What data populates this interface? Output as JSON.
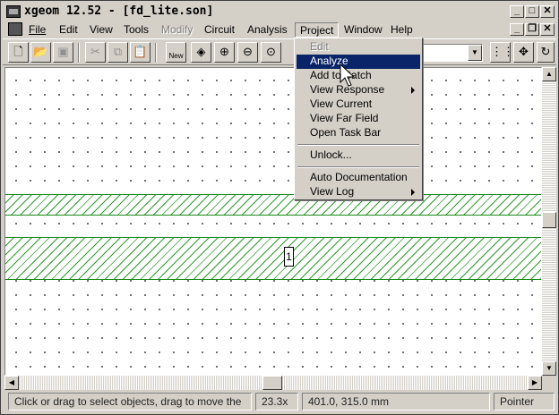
{
  "window": {
    "title": "xgeom 12.52 - [fd_lite.son]"
  },
  "menubar": {
    "items": [
      {
        "label": "File",
        "state": "normal"
      },
      {
        "label": "Edit",
        "state": "normal"
      },
      {
        "label": "View",
        "state": "normal"
      },
      {
        "label": "Tools",
        "state": "normal"
      },
      {
        "label": "Modify",
        "state": "disabled"
      },
      {
        "label": "Circuit",
        "state": "normal"
      },
      {
        "label": "Analysis",
        "state": "normal"
      },
      {
        "label": "Project",
        "state": "active"
      },
      {
        "label": "Window",
        "state": "normal"
      },
      {
        "label": "Help",
        "state": "normal"
      }
    ]
  },
  "toolbar": {
    "icons": [
      "new-file-icon",
      "open-folder-icon",
      "save-icon",
      "cut-icon",
      "copy-icon",
      "paste-icon",
      "new-project-icon",
      "3d-view-icon",
      "zoom-in-icon",
      "zoom-out-icon",
      "zoom-fit-icon",
      "grid-icon",
      "pan-icon"
    ],
    "new_label": "New"
  },
  "project_menu": {
    "items": [
      {
        "label": "Edit",
        "state": "disabled",
        "submenu": false
      },
      {
        "label": "Analyze",
        "state": "selected",
        "submenu": false
      },
      {
        "label": "Add to Batch",
        "state": "normal",
        "submenu": false
      },
      {
        "label": "View Response",
        "state": "normal",
        "submenu": true
      },
      {
        "label": "View Current",
        "state": "normal",
        "submenu": false
      },
      {
        "label": "View Far Field",
        "state": "normal",
        "submenu": false
      },
      {
        "label": "Open Task Bar",
        "state": "normal",
        "submenu": false
      },
      {
        "label": "Unlock...",
        "state": "normal",
        "submenu": false
      },
      {
        "label": "Auto Documentation",
        "state": "normal",
        "submenu": false
      },
      {
        "label": "View Log",
        "state": "normal",
        "submenu": true
      }
    ]
  },
  "canvas": {
    "port_label": "1"
  },
  "statusbar": {
    "hint": "Click or drag to select objects, drag to move the",
    "zoom": "23.3x",
    "coordinates": "401.0, 315.0 mm",
    "mode": "Pointer"
  },
  "colors": {
    "selection": "#0a246a",
    "metal_hatch": "#2c9a2c",
    "chrome": "#d4d0c8"
  }
}
